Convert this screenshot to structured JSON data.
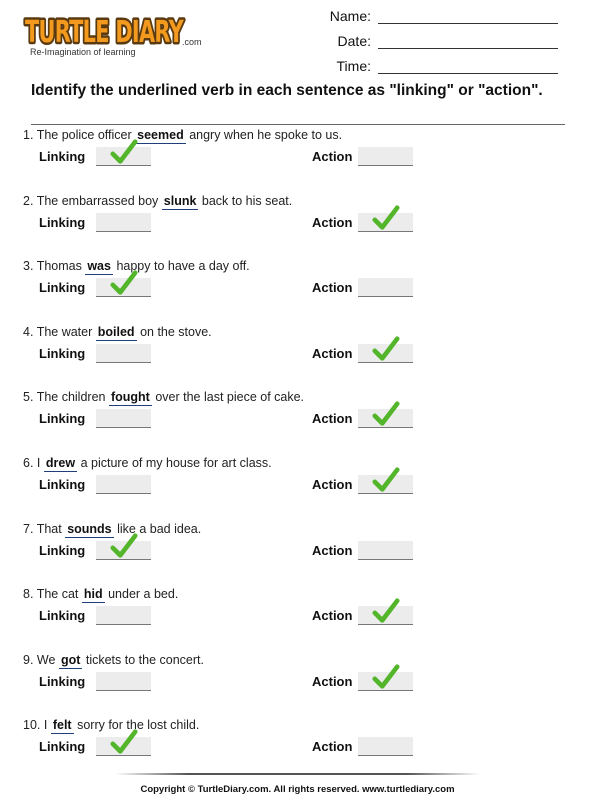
{
  "header": {
    "logo_text": "TURTLE DIARY",
    "logo_dotcom": ".com",
    "tagline": "Re-Imagination of learning",
    "name_label": "Name:",
    "date_label": "Date:",
    "time_label": "Time:"
  },
  "instructions": "Identify the underlined verb in each sentence as \"linking\" or \"action\".",
  "labels": {
    "linking": "Linking",
    "action": "Action"
  },
  "colors": {
    "check": "#52b52a",
    "verb_underline": "#1f3f7a",
    "answer_box": "#ececec",
    "logo_orange": "#f39a1e"
  },
  "questions": [
    {
      "number": "1.",
      "before": "The police officer",
      "verb": "seemed",
      "after": "angry when he spoke to us.",
      "answer": "linking"
    },
    {
      "number": "2.",
      "before": "The embarrassed boy",
      "verb": "slunk",
      "after": "back to his seat.",
      "answer": "action"
    },
    {
      "number": "3.",
      "before": "Thomas",
      "verb": "was",
      "after": "happy to have a day off.",
      "answer": "linking"
    },
    {
      "number": "4.",
      "before": "The water",
      "verb": "boiled",
      "after": "on the stove.",
      "answer": "action"
    },
    {
      "number": "5.",
      "before": "The children",
      "verb": "fought",
      "after": "over the last piece of cake.",
      "answer": "action"
    },
    {
      "number": "6.",
      "before": "I",
      "verb": "drew",
      "after": "a picture of my house for art class.",
      "answer": "action"
    },
    {
      "number": "7.",
      "before": "That",
      "verb": "sounds",
      "after": "like a bad idea.",
      "answer": "linking"
    },
    {
      "number": "8.",
      "before": "The cat",
      "verb": "hid",
      "after": "under a bed.",
      "answer": "action"
    },
    {
      "number": "9.",
      "before": "We",
      "verb": "got",
      "after": "tickets to the concert.",
      "answer": "action"
    },
    {
      "number": "10.",
      "before": "I",
      "verb": "felt",
      "after": "sorry for the lost child.",
      "answer": "linking"
    }
  ],
  "footer": "Copyright © TurtleDiary.com. All rights reserved. www.turtlediary.com"
}
